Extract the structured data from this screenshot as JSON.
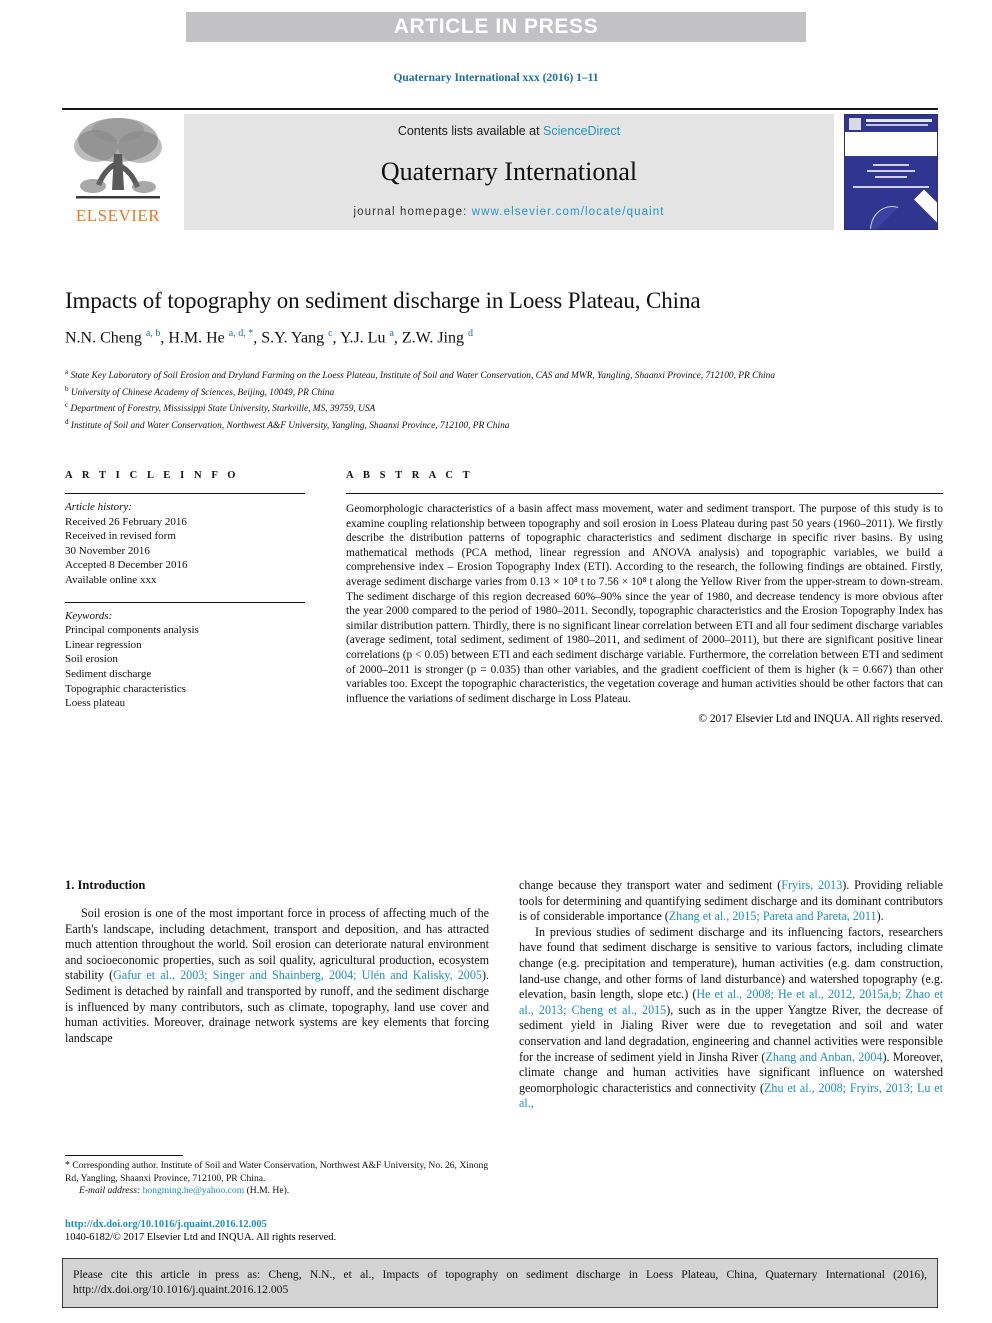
{
  "banner": {
    "text": "ARTICLE IN PRESS",
    "bg_color": "#c2c2c4"
  },
  "running_head": "Quaternary International xxx (2016) 1–11",
  "masthead": {
    "publisher_name": "ELSEVIER",
    "publisher_color": "#e87722",
    "contents_prefix": "Contents lists available at ",
    "contents_link": "ScienceDirect",
    "journal_name": "Quaternary International",
    "homepage_prefix": "journal homepage: ",
    "homepage_link": "www.elsevier.com/locate/quaint",
    "link_color": "#2196c4",
    "cover_color": "#30368f"
  },
  "article": {
    "title": "Impacts of topography on sediment discharge in Loess Plateau, China",
    "authors_html": "N.N. Cheng <sup>a, b</sup>, H.M. He <sup>a, d, *</sup>, S.Y. Yang <sup>c</sup>, Y.J. Lu <sup>a</sup>, Z.W. Jing <sup>d</sup>",
    "superscript_color": "#1a6fa8",
    "affiliations": [
      {
        "marker": "a",
        "text": "State Key Laboratory of Soil Erosion and Dryland Farming on the Loess Plateau, Institute of Soil and Water Conservation, CAS and MWR, Yangling, Shaanxi Province, 712100, PR China"
      },
      {
        "marker": "b",
        "text": "University of Chinese Academy of Sciences, Beijing, 10049, PR China"
      },
      {
        "marker": "c",
        "text": "Department of Forestry, Mississippi State University, Starkville, MS, 39759, USA"
      },
      {
        "marker": "d",
        "text": "Institute of Soil and Water Conservation, Northwest A&F University, Yangling, Shaanxi Province, 712100, PR China"
      }
    ]
  },
  "article_info": {
    "heading": "A R T I C L E  I N F O",
    "history_label": "Article history:",
    "history_lines": [
      "Received 26 February 2016",
      "Received in revised form",
      "30 November 2016",
      "Accepted 8 December 2016",
      "Available online xxx"
    ],
    "keywords_label": "Keywords:",
    "keywords": [
      "Principal components analysis",
      "Linear regression",
      "Soil erosion",
      "Sediment discharge",
      "Topographic characteristics",
      "Loess plateau"
    ]
  },
  "abstract": {
    "heading": "A B S T R A C T",
    "text": "Geomorphologic characteristics of a basin affect mass movement, water and sediment transport. The purpose of this study is to examine coupling relationship between topography and soil erosion in Loess Plateau during past 50 years (1960–2011). We firstly describe the distribution patterns of topographic characteristics and sediment discharge in specific river basins. By using mathematical methods (PCA method, linear regression and ANOVA analysis) and topographic variables, we build a comprehensive index – Erosion Topography Index (ETI). According to the research, the following findings are obtained. Firstly, average sediment discharge varies from 0.13 × 10⁸ t to 7.56 × 10⁸ t along the Yellow River from the upper-stream to down-stream. The sediment discharge of this region decreased 60%–90% since the year of 1980, and decrease tendency is more obvious after the year 2000 compared to the period of 1980–2011. Secondly, topographic characteristics and the Erosion Topography Index has similar distribution pattern. Thirdly, there is no significant linear correlation between ETI and all four sediment discharge variables (average sediment, total sediment, sediment of 1980–2011, and sediment of 2000–2011), but there are significant positive linear correlations (p < 0.05) between ETI and each sediment discharge variable. Furthermore, the correlation between ETI and sediment of 2000–2011 is stronger (p = 0.035) than other variables, and the gradient coefficient of them is higher (k = 0.667) than other variables too. Except the topographic characteristics, the vegetation coverage and human activities should be other factors that can influence the variations of sediment discharge in Loss Plateau.",
    "copyright": "© 2017 Elsevier Ltd and INQUA. All rights reserved."
  },
  "introduction": {
    "section_title": "1. Introduction",
    "left_para_html": "Soil erosion is one of the most important force in process of affecting much of the Earth's landscape, including detachment, transport and deposition, and has attracted much attention throughout the world. Soil erosion can deteriorate natural environment and socioeconomic properties, such as soil quality, agricultural production, ecosystem stability (<span class=\"cite\">Gafur et al., 2003; Singer and Shainberg, 2004; Ulén and Kalisky, 2005</span>). Sediment is detached by rainfall and transported by runoff, and the sediment discharge is influenced by many contributors, such as climate, topography, land use cover and human activities. Moreover, drainage network systems are key elements that forcing landscape",
    "right_para1_html": "change because they transport water and sediment (<span class=\"cite\">Fryirs, 2013</span>). Providing reliable tools for determining and quantifying sediment discharge and its dominant contributors is of considerable importance (<span class=\"cite\">Zhang et al., 2015; Pareta and Pareta, 2011</span>).",
    "right_para2_html": "In previous studies of sediment discharge and its influencing factors, researchers have found that sediment discharge is sensitive to various factors, including climate change (e.g. precipitation and temperature), human activities (e.g. dam construction, land-use change, and other forms of land disturbance) and watershed topography (e.g. elevation, basin length, slope etc.) (<span class=\"cite\">He et al., 2008; He et al., 2012, 2015a,b; Zhao et al., 2013; Cheng et al., 2015</span>), such as in the upper Yangtze River, the decrease of sediment yield in Jialing River were due to revegetation and soil and water conservation and land degradation, engineering and channel activities were responsible for the increase of sediment yield in Jinsha River (<span class=\"cite\">Zhang and Anban, 2004</span>). Moreover, climate change and human activities have significant influence on watershed geomorphologic characteristics and connectivity (<span class=\"cite\">Zhu et al., 2008; Fryirs, 2013; Lu et al.,</span>"
  },
  "footnote": {
    "corresponding_html": "<span class=\"star\">*</span> Corresponding author. Institute of Soil and Water Conservation, Northwest A&amp;F University, No. 26, Xinong Rd, Yangling, Shaanxi Province, 712100, PR China.",
    "email_label": "E-mail address:",
    "email": "hongming.he@yahoo.com",
    "email_owner": "(H.M. He)."
  },
  "doi_block": {
    "doi_url": "http://dx.doi.org/10.1016/j.quaint.2016.12.005",
    "issn_line": "1040-6182/© 2017 Elsevier Ltd and INQUA. All rights reserved."
  },
  "cite_box": {
    "text": "Please cite this article in press as: Cheng, N.N., et al., Impacts of topography on sediment discharge in Loess Plateau, China, Quaternary International (2016), http://dx.doi.org/10.1016/j.quaint.2016.12.005",
    "bg_color": "#d4d4d4"
  }
}
